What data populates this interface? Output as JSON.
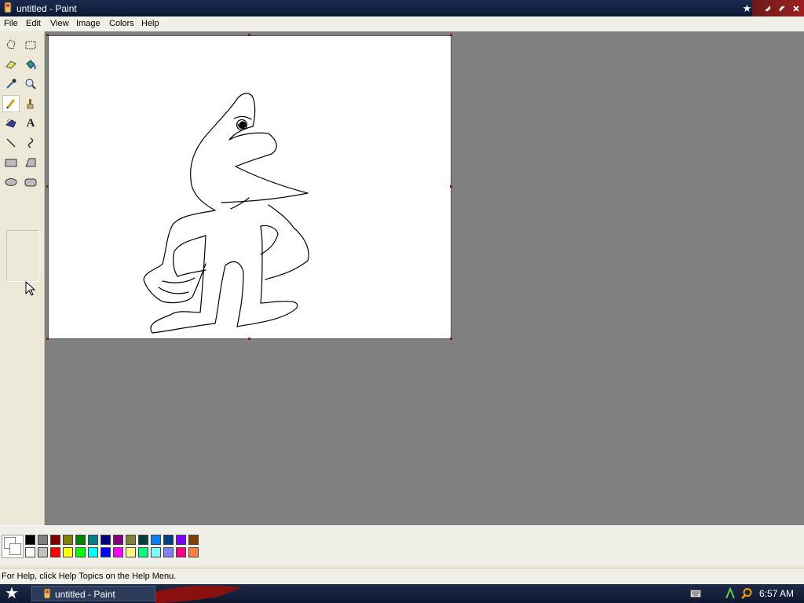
{
  "window": {
    "title": "untitled - Paint"
  },
  "menu": {
    "items": [
      "File",
      "Edit",
      "View",
      "Image",
      "Colors",
      "Help"
    ]
  },
  "tools": [
    "free-select",
    "rect-select",
    "eraser",
    "fill",
    "color-picker",
    "magnifier",
    "pencil",
    "brush",
    "airbrush",
    "text",
    "line",
    "curve",
    "rectangle",
    "polygon",
    "ellipse",
    "rounded-rectangle"
  ],
  "palette": {
    "top": [
      "#000000",
      "#808080",
      "#800000",
      "#808000",
      "#008000",
      "#008080",
      "#000080",
      "#800080",
      "#808040",
      "#004040",
      "#0080ff",
      "#004080",
      "#8000ff",
      "#804000"
    ],
    "bottom": [
      "#ffffff",
      "#c0c0c0",
      "#ff0000",
      "#ffff00",
      "#00ff00",
      "#00ffff",
      "#0000ff",
      "#ff00ff",
      "#ffff80",
      "#00ff80",
      "#80ffff",
      "#8080ff",
      "#ff0080",
      "#ff8040"
    ]
  },
  "status": {
    "text": "For Help, click Help Topics on the Help Menu."
  },
  "taskbar": {
    "task_label": "untitled - Paint",
    "clock": "6:57 AM"
  },
  "colors": {
    "workspace": "#808080",
    "titlebar": "#1b2a4e",
    "canvas": "#ffffff"
  }
}
